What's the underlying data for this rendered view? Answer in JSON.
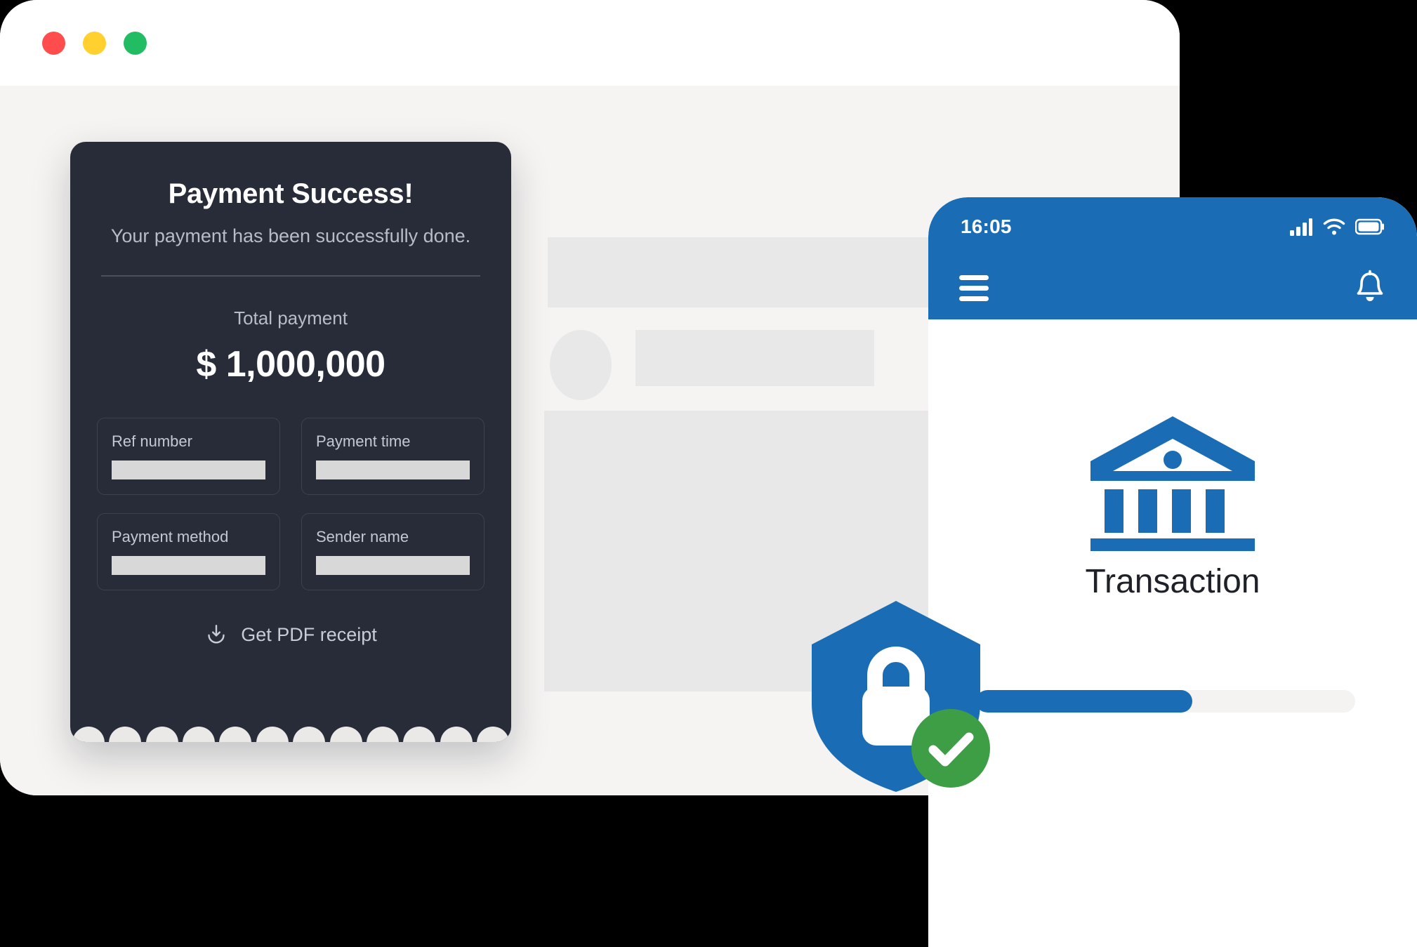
{
  "browser": {
    "traffic_lights": [
      {
        "name": "close",
        "color": "#FF4C4C"
      },
      {
        "name": "minimize",
        "color": "#FFD02E"
      },
      {
        "name": "maximize",
        "color": "#22BD62"
      }
    ],
    "skeleton_placeholders": [
      "banner",
      "avatar",
      "text-line",
      "content-block"
    ]
  },
  "receipt": {
    "title": "Payment Success!",
    "subtitle": "Your payment has been successfully done.",
    "total_label": "Total payment",
    "total_amount": "$ 1,000,000",
    "fields": [
      {
        "label": "Ref number",
        "value": ""
      },
      {
        "label": "Payment time",
        "value": ""
      },
      {
        "label": "Payment method",
        "value": ""
      },
      {
        "label": "Sender name",
        "value": ""
      }
    ],
    "pdf_link_label": "Get PDF receipt",
    "pdf_icon": "download-icon",
    "card_color": "#272C38",
    "notch_count": 12
  },
  "phone": {
    "status": {
      "time": "16:05",
      "icons": [
        "signal-icon",
        "wifi-icon",
        "battery-icon"
      ]
    },
    "nav": {
      "menu_icon": "hamburger-menu-icon",
      "notification_icon": "bell-icon"
    },
    "content": {
      "bank_icon": "bank-icon",
      "caption": "Transaction",
      "progress_percent": 57
    },
    "accent_color": "#1A6DB5"
  },
  "badge": {
    "shield_icon": "shield-icon",
    "lock_icon": "lock-icon",
    "check_icon": "check-circle-icon",
    "shield_color": "#1A6DB5",
    "check_color": "#3E9E46"
  }
}
